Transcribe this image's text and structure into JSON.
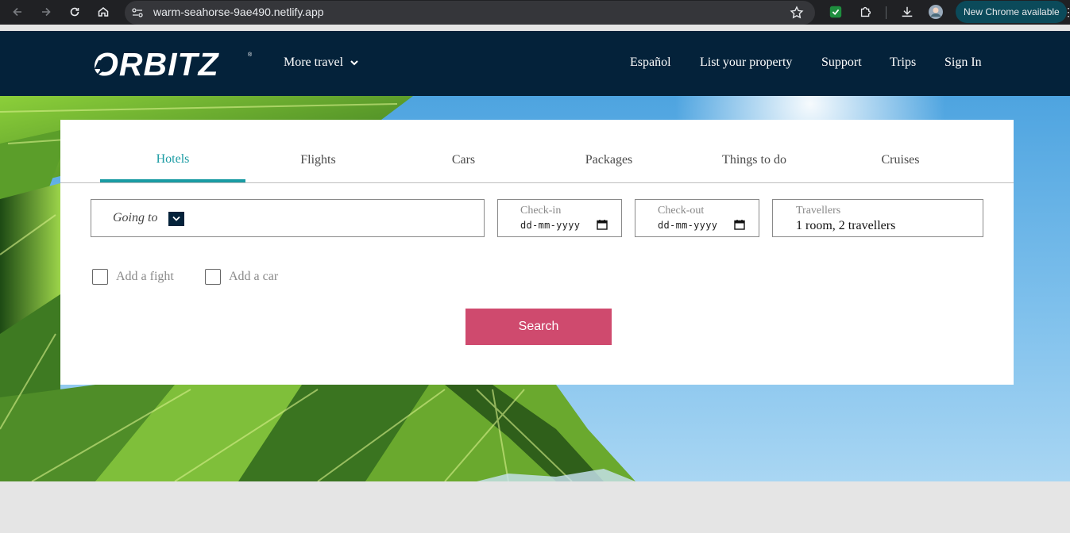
{
  "browser": {
    "url": "warm-seahorse-9ae490.netlify.app",
    "update_label": "New Chrome available",
    "icons": [
      "back-icon",
      "forward-icon",
      "reload-icon",
      "home-icon",
      "site-info-icon",
      "bookmark-star-icon",
      "extension-shield-icon",
      "extensions-puzzle-icon",
      "download-icon",
      "profile-avatar-icon",
      "menu-kebab-icon"
    ]
  },
  "header": {
    "logo_text": "ORBITZ",
    "more_travel": "More travel",
    "links": [
      "Español",
      "List your property",
      "Support",
      "Trips",
      "Sign In"
    ]
  },
  "search": {
    "tabs": [
      "Hotels",
      "Flights",
      "Cars",
      "Packages",
      "Things to do",
      "Cruises"
    ],
    "active_tab": "Hotels",
    "going_to_label": "Going to",
    "checkin_label": "Check-in",
    "checkin_value": "dd-mm-yyyy",
    "checkout_label": "Check-out",
    "checkout_value": "dd-mm-yyyy",
    "travellers_label": "Travellers",
    "travellers_value": "1 room, 2 travellers",
    "addons": [
      "Add a fight",
      "Add a car"
    ],
    "search_button": "Search"
  },
  "colors": {
    "header_bg": "#04223a",
    "accent_teal": "#1a9ba3",
    "search_button": "#cf4a6e",
    "chrome_bg": "#202124"
  }
}
